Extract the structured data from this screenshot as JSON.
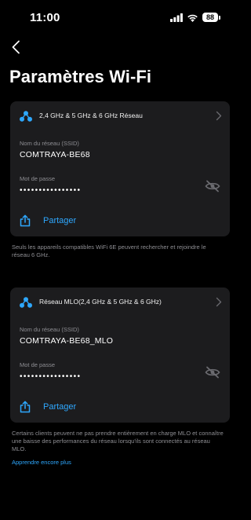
{
  "status_bar": {
    "time": "11:00",
    "battery": "88",
    "icons": [
      "signal-icon",
      "wifi-icon",
      "battery-icon"
    ]
  },
  "header": {
    "back_icon": "chevron-left-icon",
    "title": "Paramètres Wi-Fi"
  },
  "networks": [
    {
      "title": "2,4 GHz & 5 GHz & 6 GHz Réseau",
      "ssid_label": "Nom du réseau (SSID)",
      "ssid": "COMTRAYA-BE68",
      "password_label": "Mot de passe",
      "password": "••••••••••••••••",
      "share_label": "Partager"
    },
    {
      "title": "Réseau MLO(2,4 GHz & 5 GHz & 6 GHz)",
      "ssid_label": "Nom du réseau (SSID)",
      "ssid": "COMTRAYA-BE68_MLO",
      "password_label": "Mot de passe",
      "password": "••••••••••••••••",
      "share_label": "Partager"
    }
  ],
  "notes": {
    "wifi6e": "Seuls les appareils compatibles WiFi 6E peuvent rechercher et rejoindre le réseau 6 GHz.",
    "mlo": "Certains clients peuvent ne pas prendre entièrement en charge MLO et connaître une baisse des performances du réseau lorsqu'ils sont connectés au réseau MLO.",
    "learn_more": "Apprendre encore plus"
  },
  "colors": {
    "background": "#000000",
    "card": "#1c1c1e",
    "accent": "#2ea8ff",
    "secondary_text": "#8e8e93"
  }
}
